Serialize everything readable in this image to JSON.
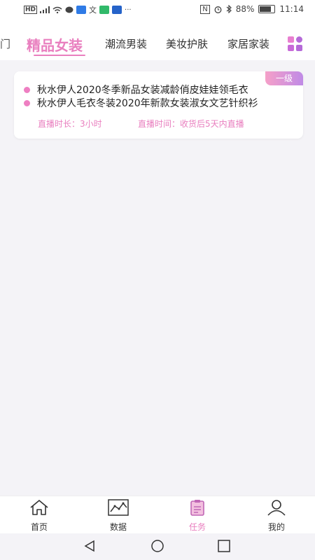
{
  "status_bar": {
    "left_icons": [
      "hd-icon",
      "signal-icon",
      "wifi-icon",
      "message-icon",
      "app-icon",
      "translate-icon",
      "app-icon",
      "app-icon",
      "more-dots-icon"
    ],
    "battery": "88%",
    "time": "11:14"
  },
  "categories": {
    "partial_left": "门",
    "items": [
      "精品女装",
      "潮流男装",
      "美妆护肤",
      "家居家装"
    ],
    "active_index": 0
  },
  "task_card": {
    "badge": "一级",
    "products": [
      "秋水伊人2020冬季新品女装减龄俏皮娃娃领毛衣",
      "秋水伊人毛衣冬装2020年新款女装淑女文艺针织衫"
    ],
    "duration": "直播时长：3小时",
    "live_time": "直播时间：收货后5天内直播"
  },
  "tabs": [
    {
      "label": "首页",
      "icon": "home-icon"
    },
    {
      "label": "数据",
      "icon": "chart-icon"
    },
    {
      "label": "任务",
      "icon": "clipboard-icon",
      "active": true
    },
    {
      "label": "我的",
      "icon": "user-icon"
    }
  ],
  "colors": {
    "accent": "#e97fbf",
    "badge_gradient_start": "#f5a0c8",
    "badge_gradient_end": "#c08ae6",
    "background": "#f4f3f7"
  }
}
